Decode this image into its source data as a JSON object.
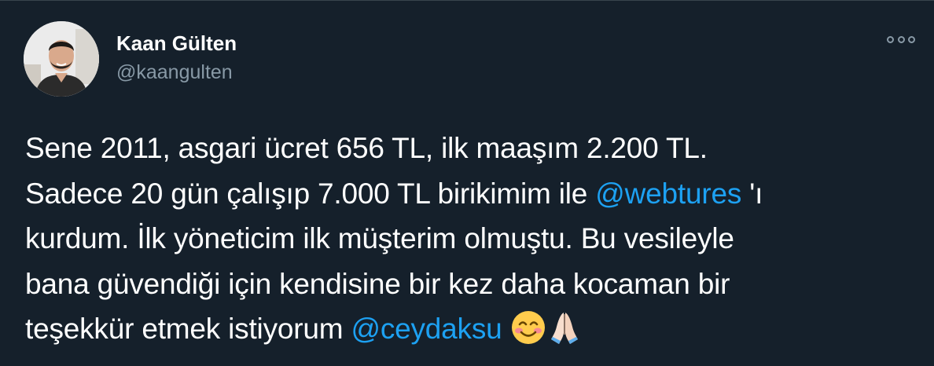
{
  "author": {
    "display_name": "Kaan Gülten",
    "handle": "@kaangulten"
  },
  "actions": {
    "more_icon": "more-horizontal-icon"
  },
  "tweet": {
    "line1": "Sene 2011, asgari ücret 656 TL, ilk maaşım 2.200 TL.",
    "line2_before": "Sadece 20 gün çalışıp 7.000 TL birikimim ile ",
    "mention1": "@webtures",
    "line2_after": " 'ı",
    "line3": "kurdum. İlk yöneticim ilk müşterim olmuştu. Bu vesileyle",
    "line4": "bana güvendiği için kendisine bir kez daha kocaman bir",
    "line5_before": "teşekkür etmek istiyorum ",
    "mention2": "@ceydaksu",
    "emojis": [
      "smiling-face-emoji",
      "folded-hands-emoji"
    ]
  },
  "colors": {
    "background": "#15202b",
    "text": "#ffffff",
    "secondary": "#8899a6",
    "link": "#1da1f2"
  }
}
